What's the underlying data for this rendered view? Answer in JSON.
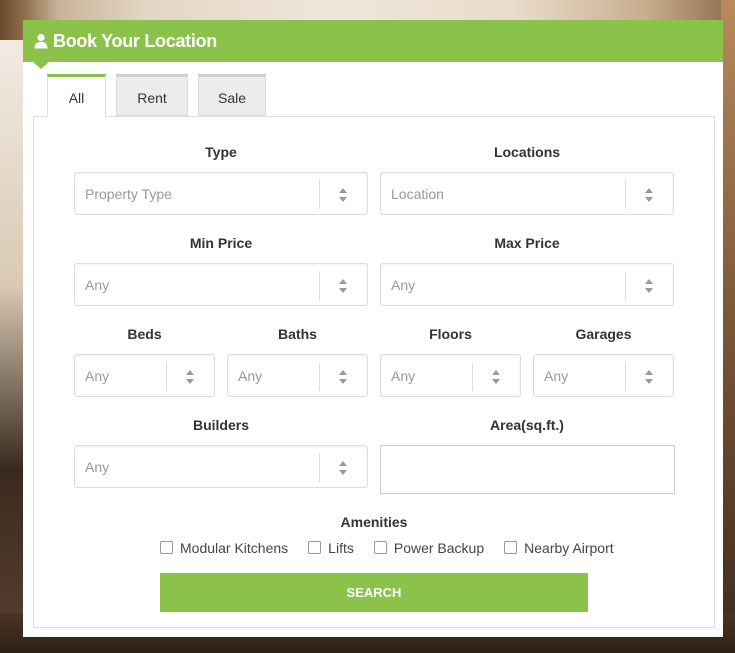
{
  "header": {
    "title": "Book Your Location",
    "icon": "user-icon",
    "accent_color": "#8bc34a"
  },
  "tabs": [
    {
      "label": "All",
      "active": true
    },
    {
      "label": "Rent",
      "active": false
    },
    {
      "label": "Sale",
      "active": false
    }
  ],
  "fields": {
    "type": {
      "label": "Type",
      "placeholder": "Property Type"
    },
    "locations": {
      "label": "Locations",
      "placeholder": "Location"
    },
    "min_price": {
      "label": "Min Price",
      "placeholder": "Any"
    },
    "max_price": {
      "label": "Max Price",
      "placeholder": "Any"
    },
    "beds": {
      "label": "Beds",
      "placeholder": "Any"
    },
    "baths": {
      "label": "Baths",
      "placeholder": "Any"
    },
    "floors": {
      "label": "Floors",
      "placeholder": "Any"
    },
    "garages": {
      "label": "Garages",
      "placeholder": "Any"
    },
    "builders": {
      "label": "Builders",
      "placeholder": "Any"
    },
    "area": {
      "label": "Area(sq.ft.)",
      "value": ""
    }
  },
  "amenities": {
    "label": "Amenities",
    "items": [
      {
        "label": "Modular Kitchens",
        "checked": false
      },
      {
        "label": "Lifts",
        "checked": false
      },
      {
        "label": "Power Backup",
        "checked": false
      },
      {
        "label": "Nearby Airport",
        "checked": false
      }
    ]
  },
  "search_button": {
    "label": "SEARCH"
  }
}
